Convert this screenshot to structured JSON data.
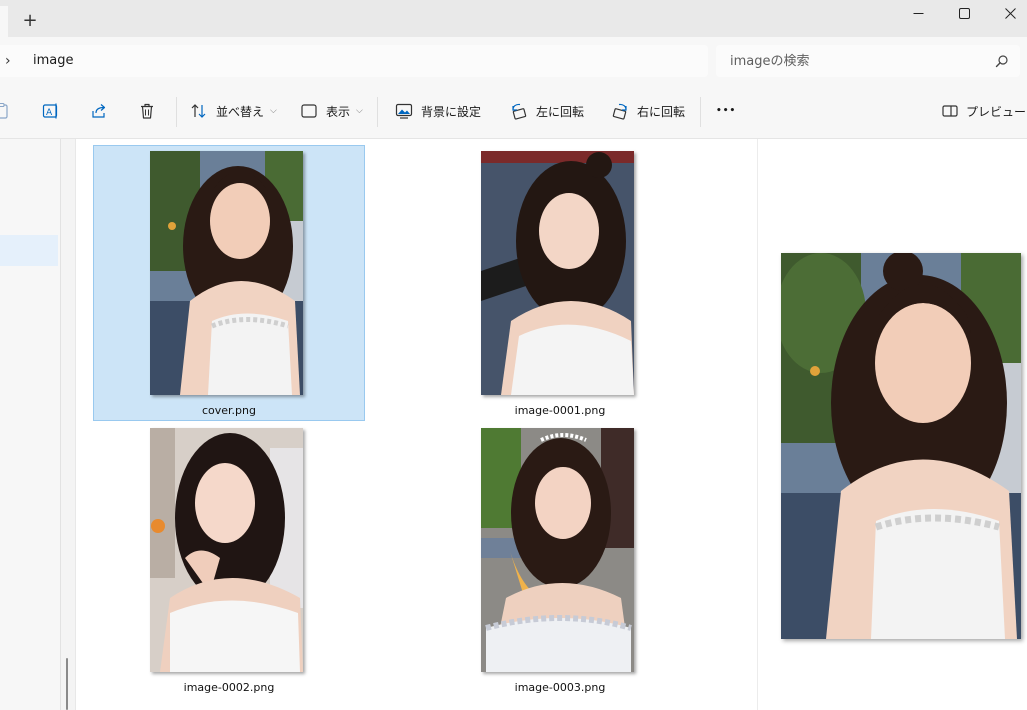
{
  "window": {
    "new_tab": "+",
    "minimize": "—",
    "maximize": "☐",
    "close": "✕"
  },
  "address": {
    "chevron": "›",
    "path": "image"
  },
  "search": {
    "placeholder": "imageの検索"
  },
  "toolbar": {
    "sort_label": "並べ替え",
    "view_label": "表示",
    "set_background_label": "背景に設定",
    "rotate_left_label": "左に回転",
    "rotate_right_label": "右に回転",
    "more_label": "•••",
    "preview_label": "プレビュー"
  },
  "files": [
    {
      "name": "cover.png",
      "selected": true
    },
    {
      "name": "image-0001.png",
      "selected": false
    },
    {
      "name": "image-0002.png",
      "selected": false
    },
    {
      "name": "image-0003.png",
      "selected": false
    }
  ],
  "colors": {
    "selection_fill": "#cce4f7",
    "selection_border": "#99c9ef",
    "accent_blue": "#0067c0"
  }
}
